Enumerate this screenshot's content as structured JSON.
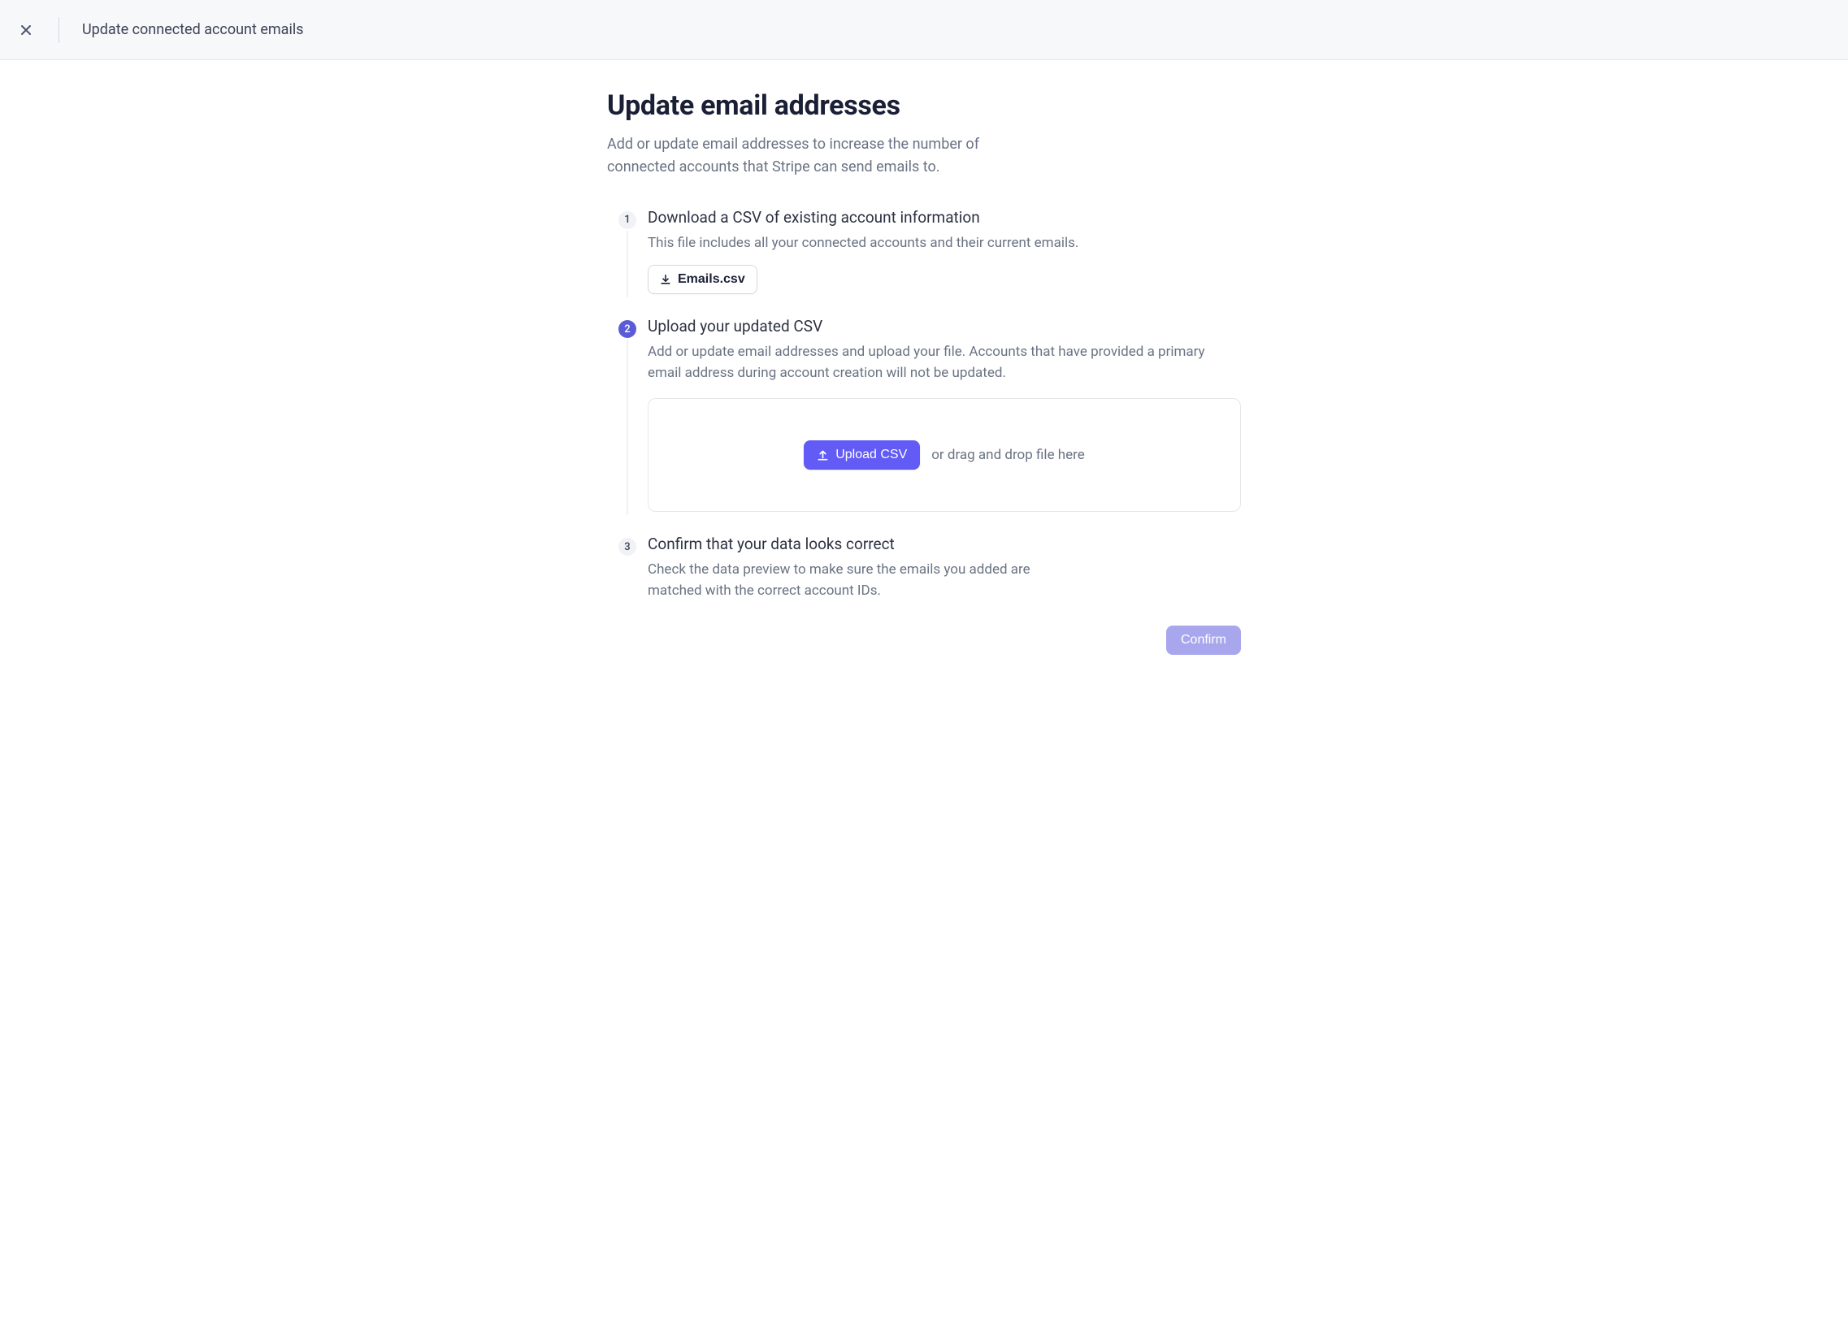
{
  "header": {
    "title": "Update connected account emails"
  },
  "page": {
    "title": "Update email addresses",
    "subtitle": "Add or update email addresses to increase the number of connected accounts that Stripe can send emails to."
  },
  "steps": [
    {
      "number": "1",
      "title": "Download a CSV of existing account information",
      "desc": "This file includes all your connected accounts and their current emails.",
      "download_label": "Emails.csv",
      "active": false
    },
    {
      "number": "2",
      "title": "Upload your updated CSV",
      "desc": "Add or update email addresses and upload your file. Accounts that have provided a primary email address during account creation will not be updated.",
      "upload_label": "Upload CSV",
      "drop_hint": "or drag and drop file here",
      "active": true
    },
    {
      "number": "3",
      "title": "Confirm that your data looks correct",
      "desc": "Check the data preview to make sure the emails you added are matched with the correct account IDs.",
      "active": false
    }
  ],
  "footer": {
    "confirm_label": "Confirm"
  },
  "colors": {
    "accent": "#625bf6",
    "accent_disabled": "#a8a7ee",
    "text_muted": "#6a7383"
  }
}
